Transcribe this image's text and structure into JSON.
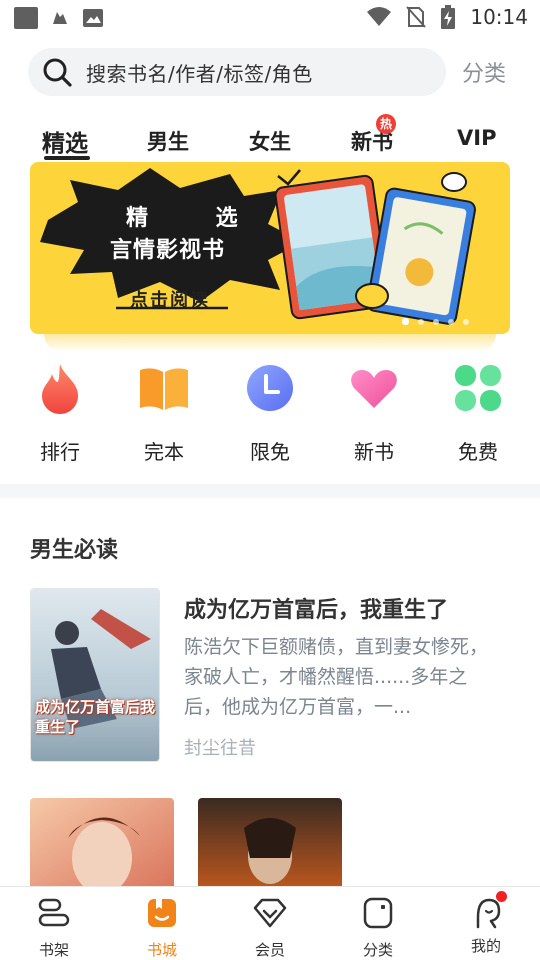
{
  "status_bar": {
    "time": "10:14"
  },
  "search": {
    "placeholder": "搜索书名/作者/标签/角色"
  },
  "header": {
    "category_link": "分类"
  },
  "tabs": [
    {
      "label": "精选",
      "active": true
    },
    {
      "label": "男生"
    },
    {
      "label": "女生"
    },
    {
      "label": "新书",
      "badge": "热"
    },
    {
      "label": "VIP"
    }
  ],
  "banner": {
    "line1": "精 选",
    "line2": "言情影视书",
    "cta": "点击阅读",
    "page_index": 1,
    "page_count": 5,
    "background_color": "#fdd53a"
  },
  "entries": [
    {
      "label": "排行",
      "icon": "flame-icon"
    },
    {
      "label": "完本",
      "icon": "open-book-icon"
    },
    {
      "label": "限免",
      "icon": "clock-icon"
    },
    {
      "label": "新书",
      "icon": "heart-icon"
    },
    {
      "label": "免费",
      "icon": "clover-icon"
    }
  ],
  "section": {
    "title": "男生必读",
    "featured": {
      "title": "成为亿万首富后，我重生了",
      "description": "陈浩欠下巨额赌债，直到妻女惨死，家破人亡，才幡然醒悟......多年之后，他成为亿万首富，一...",
      "author": "封尘往昔",
      "cover_text": "成为亿万首富后我重生了"
    }
  },
  "bottom_nav": [
    {
      "label": "书架",
      "icon": "bookshelf-icon"
    },
    {
      "label": "书城",
      "icon": "bookstore-icon",
      "active": true
    },
    {
      "label": "会员",
      "icon": "diamond-icon"
    },
    {
      "label": "分类",
      "icon": "category-icon"
    },
    {
      "label": "我的",
      "icon": "profile-icon",
      "has_notification": true
    }
  ],
  "colors": {
    "accent": "#f08419",
    "badge_red": "#ee3e36",
    "muted_text": "#7d8590"
  }
}
